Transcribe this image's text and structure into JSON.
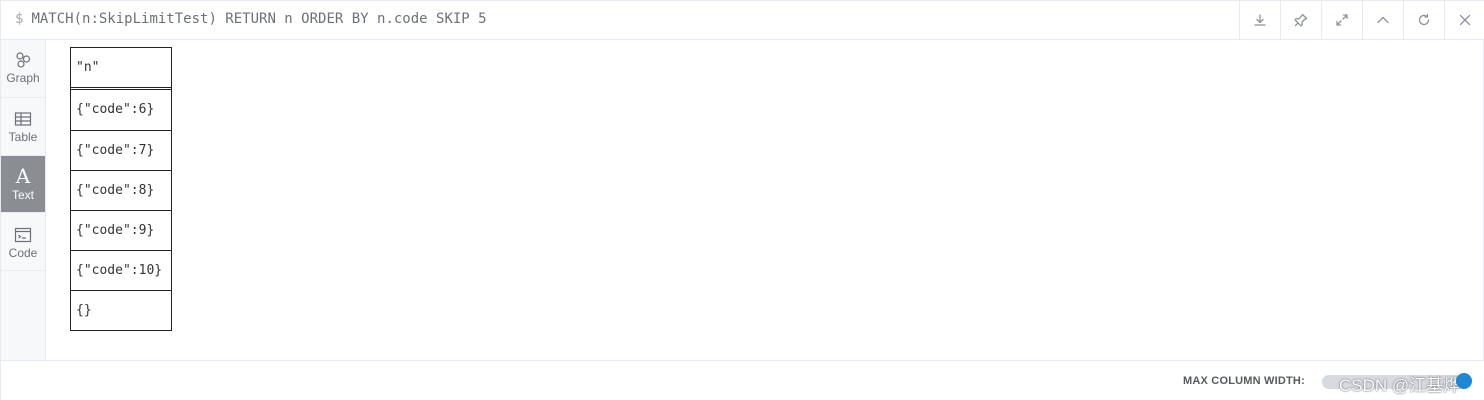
{
  "query": {
    "prompt": "$",
    "text": "MATCH(n:SkipLimitTest) RETURN n ORDER BY n.code SKIP 5"
  },
  "actions": [
    {
      "name": "download-icon"
    },
    {
      "name": "pin-icon"
    },
    {
      "name": "fullscreen-icon"
    },
    {
      "name": "collapse-icon"
    },
    {
      "name": "rerun-icon"
    },
    {
      "name": "close-icon"
    }
  ],
  "sidebar": {
    "views": [
      {
        "label": "Graph",
        "icon": "graph-icon",
        "active": false
      },
      {
        "label": "Table",
        "icon": "table-icon",
        "active": false
      },
      {
        "label": "Text",
        "icon": "text-icon",
        "glyph": "A",
        "active": true
      },
      {
        "label": "Code",
        "icon": "code-icon",
        "active": false
      }
    ]
  },
  "result": {
    "header": "\"n\"",
    "rows": [
      "{\"code\":6}",
      "{\"code\":7}",
      "{\"code\":8}",
      "{\"code\":9}",
      "{\"code\":10}",
      "{}"
    ]
  },
  "footer": {
    "max_column_width_label": "MAX COLUMN WIDTH:",
    "watermark": "CSDN @江基烨"
  },
  "colors": {
    "active_view": "#8a8d91",
    "slider_knob": "#1f88d6"
  }
}
